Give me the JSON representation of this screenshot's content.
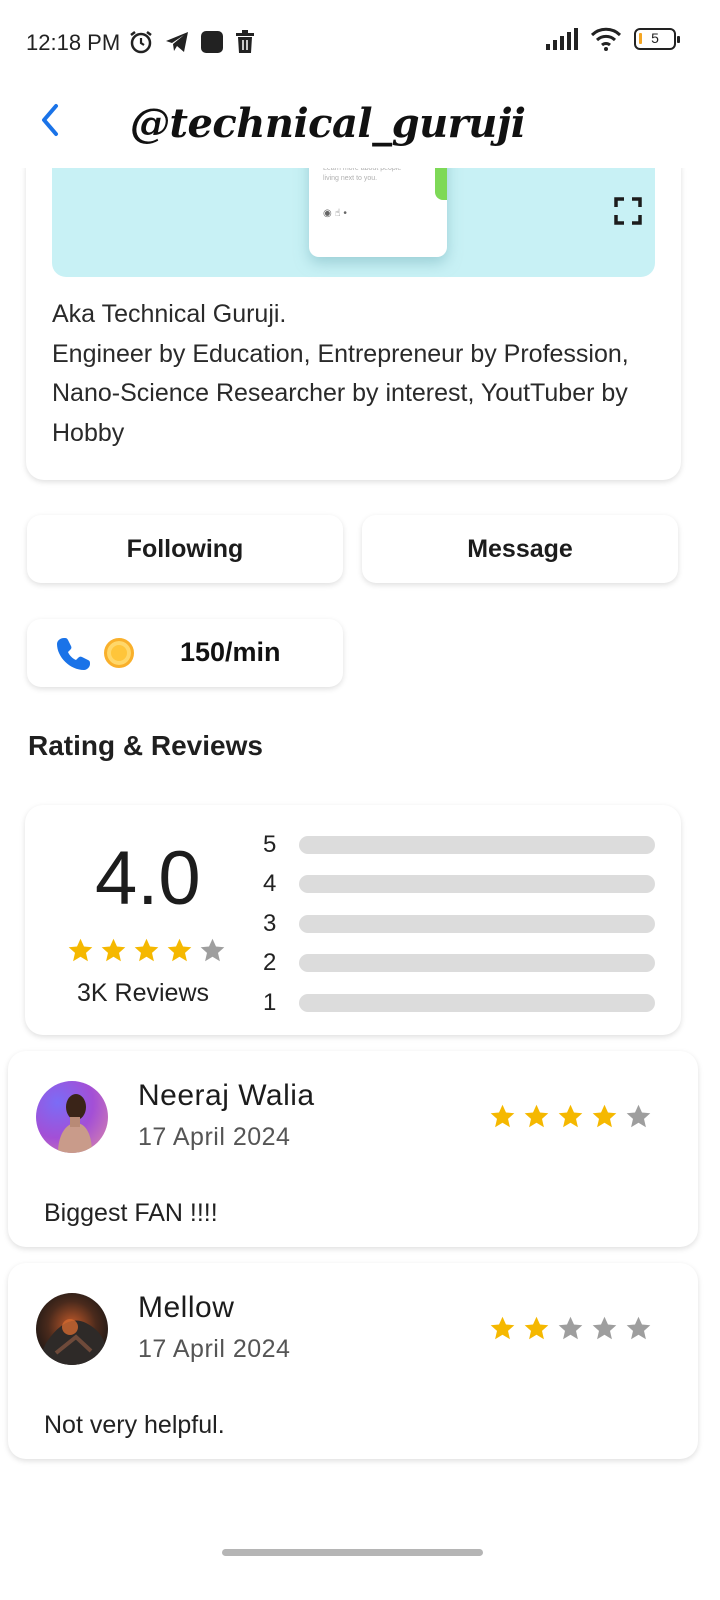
{
  "status_bar": {
    "time": "12:18 PM",
    "battery": "5",
    "icons_left": [
      "alarm-icon",
      "telegram-icon",
      "app-square-icon",
      "trash-icon"
    ],
    "icons_right": [
      "signal-icon",
      "wifi-icon",
      "battery-icon"
    ]
  },
  "header": {
    "handle": "@technical_guruji",
    "back_icon": "chevron-left-icon"
  },
  "profile": {
    "bio_line1": "Aka Technical Guruji.",
    "bio_line2": "Engineer by Education, Entrepreneur by Profession, Nano-Science Researcher by interest, YoutTuber by Hobby"
  },
  "actions": {
    "following_label": "Following",
    "message_label": "Message",
    "call_rate": "150/min"
  },
  "reviews_section": {
    "title": "Rating & Reviews",
    "average": "4.0",
    "average_stars": 4,
    "count_label": "3K Reviews",
    "distribution": [
      {
        "label": "5",
        "fraction": 0
      },
      {
        "label": "4",
        "fraction": 0
      },
      {
        "label": "3",
        "fraction": 0
      },
      {
        "label": "2",
        "fraction": 0
      },
      {
        "label": "1",
        "fraction": 0
      }
    ]
  },
  "reviews": [
    {
      "name": "Neeraj Walia",
      "date": "17 April 2024",
      "stars": 4,
      "text": "Biggest FAN !!!!"
    },
    {
      "name": "Mellow",
      "date": "17 April 2024",
      "stars": 2,
      "text": "Not very helpful."
    }
  ],
  "colors": {
    "accent_blue": "#1a73e8",
    "star_filled": "#f5b800",
    "star_empty": "#9e9e9e",
    "cover_bg": "#c8f1f5"
  }
}
